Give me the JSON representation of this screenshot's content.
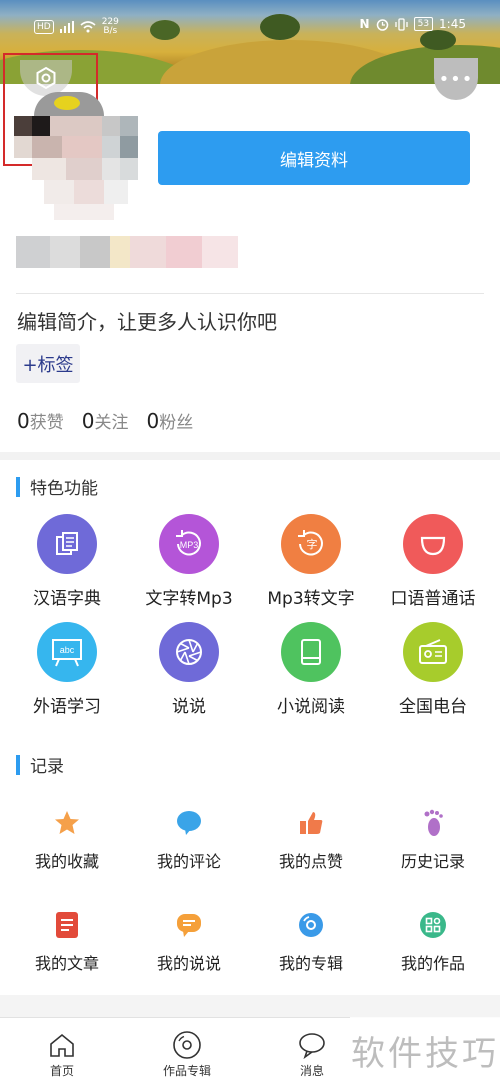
{
  "status_bar": {
    "hd": "HD",
    "net_top": "229",
    "net_bottom": "B/s",
    "battery": "53",
    "time": "1:45"
  },
  "profile": {
    "edit_button": "编辑资料",
    "bio_prompt": "编辑简介，让更多人认识你吧",
    "tag_button": "+标签",
    "stats": [
      {
        "count": "0",
        "label": "获赞"
      },
      {
        "count": "0",
        "label": "关注"
      },
      {
        "count": "0",
        "label": "粉丝"
      }
    ],
    "more": "•••"
  },
  "features": {
    "title": "特色功能",
    "items": [
      {
        "label": "汉语字典",
        "icon": "dictionary-icon",
        "color": "#6f6ad8"
      },
      {
        "label": "文字转Mp3",
        "icon": "mp3-icon",
        "color": "#b455d8"
      },
      {
        "label": "Mp3转文字",
        "icon": "text-icon",
        "color": "#f07f42"
      },
      {
        "label": "口语普通话",
        "icon": "mouth-icon",
        "color": "#f05a5a"
      },
      {
        "label": "外语学习",
        "icon": "abc-board-icon",
        "color": "#36b6ee"
      },
      {
        "label": "说说",
        "icon": "aperture-icon",
        "color": "#6f6ad8"
      },
      {
        "label": "小说阅读",
        "icon": "book-icon",
        "color": "#4fc35f"
      },
      {
        "label": "全国电台",
        "icon": "radio-icon",
        "color": "#a7cc2c"
      }
    ],
    "mp3_text": "MP3",
    "char_text": "字",
    "abc_text": "abc"
  },
  "records": {
    "title": "记录",
    "items": [
      {
        "label": "我的收藏",
        "icon": "star-icon",
        "color": "#f5a04a"
      },
      {
        "label": "我的评论",
        "icon": "comment-icon",
        "color": "#3aa4e8"
      },
      {
        "label": "我的点赞",
        "icon": "thumbs-up-icon",
        "color": "#f07a4a"
      },
      {
        "label": "历史记录",
        "icon": "footprint-icon",
        "color": "#b070c8"
      },
      {
        "label": "我的文章",
        "icon": "article-icon",
        "color": "#e24a3a"
      },
      {
        "label": "我的说说",
        "icon": "chat-icon",
        "color": "#f5a03a"
      },
      {
        "label": "我的专辑",
        "icon": "album-icon",
        "color": "#3a9ae8"
      },
      {
        "label": "我的作品",
        "icon": "works-icon",
        "color": "#3ab88a"
      }
    ]
  },
  "tabbar": {
    "items": [
      {
        "label": "首页",
        "icon": "home-icon"
      },
      {
        "label": "作品专辑",
        "icon": "disc-icon"
      },
      {
        "label": "消息",
        "icon": "message-icon"
      }
    ]
  },
  "watermark": "软件技巧"
}
